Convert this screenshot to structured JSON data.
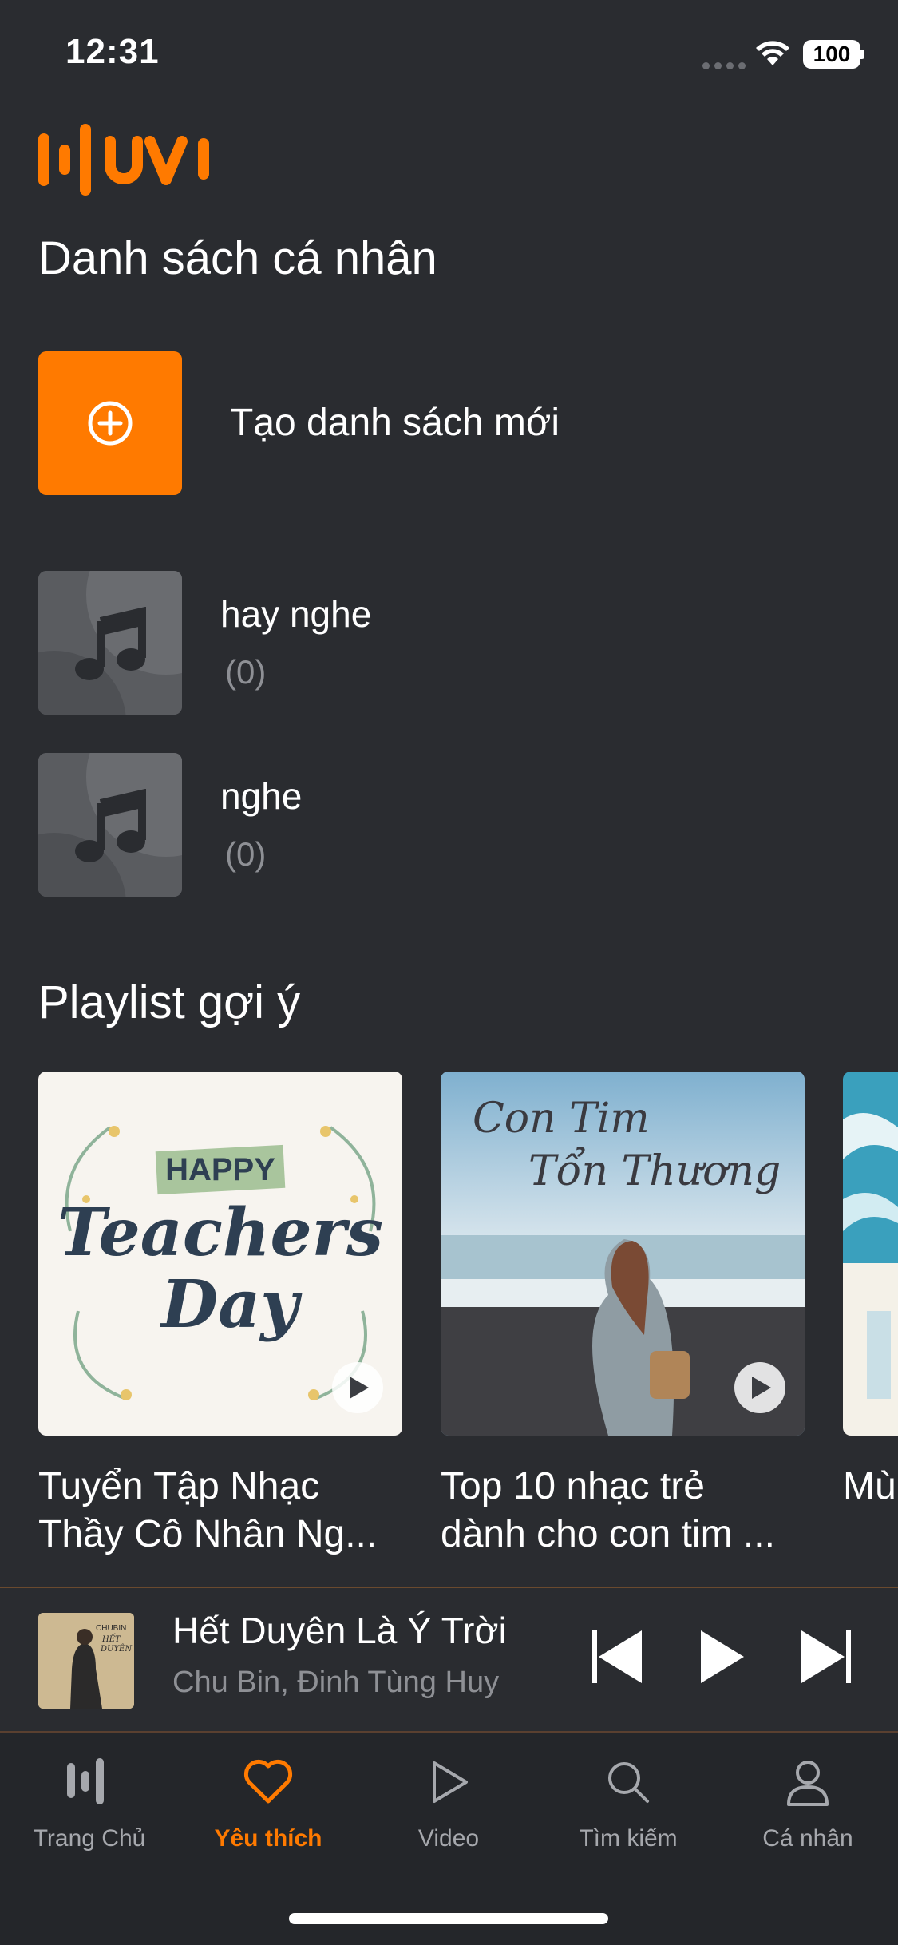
{
  "status": {
    "time": "12:31",
    "battery": "100"
  },
  "logo": {
    "text": "MUVI",
    "color": "#ff7a00"
  },
  "personal": {
    "title": "Danh sách cá nhân",
    "create_label": "Tạo danh sách mới",
    "playlists": [
      {
        "name": "hay nghe",
        "count": "(0)",
        "icon": "music-note-icon"
      },
      {
        "name": "nghe",
        "count": "(0)",
        "icon": "music-note-icon"
      }
    ]
  },
  "suggested": {
    "title": "Playlist gợi ý",
    "cards": [
      {
        "line1": "Tuyển Tập Nhạc",
        "line2": "Thầy Cô Nhân Ng...",
        "art_text": [
          "HAPPY",
          "Teachers",
          "Day"
        ]
      },
      {
        "line1": "Top 10 nhạc trẻ",
        "line2": "dành cho con tim ...",
        "art_text": [
          "Con Tim",
          "Tổn Thương"
        ]
      },
      {
        "line1": "Mù",
        "line2": ""
      }
    ]
  },
  "now_playing": {
    "title": "Hết Duyên Là Ý Trời",
    "artist": "Chu Bin, Đinh Tùng Huy",
    "cover_text": [
      "CHUBIN",
      "HẾT",
      "DUYÊN"
    ]
  },
  "tabs": [
    {
      "label": "Trang Chủ",
      "icon": "home-bars-icon",
      "active": false
    },
    {
      "label": "Yêu thích",
      "icon": "heart-icon",
      "active": true
    },
    {
      "label": "Video",
      "icon": "play-outline-icon",
      "active": false
    },
    {
      "label": "Tìm kiếm",
      "icon": "search-icon",
      "active": false
    },
    {
      "label": "Cá nhân",
      "icon": "person-icon",
      "active": false
    }
  ],
  "colors": {
    "accent": "#ff7a00",
    "background": "#2a2c30",
    "muted": "#8e9095"
  }
}
